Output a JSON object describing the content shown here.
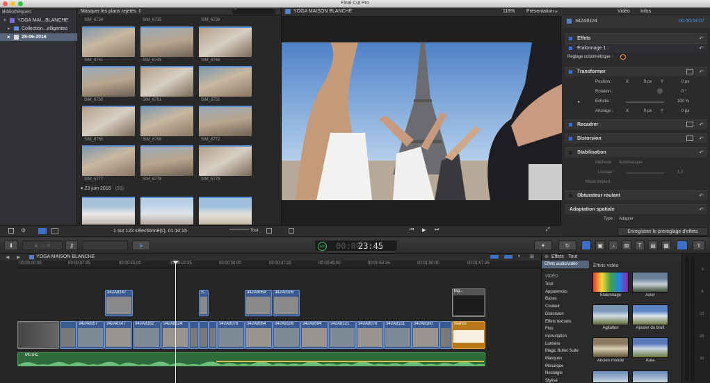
{
  "window": {
    "title": "Final Cut Pro"
  },
  "library": {
    "header": "Bibliothèques",
    "items": [
      {
        "label": "YOGA MAI...BLANCHE",
        "selected": false
      },
      {
        "label": "Collection...elligentes",
        "selected": false
      },
      {
        "label": "29-06-2016",
        "selected": true
      }
    ]
  },
  "browser": {
    "filter": "Masquer les plans rejetés",
    "top_labels": [
      "SIM_6734",
      "SIM_6735",
      "SIM_6736"
    ],
    "rows": [
      [
        "SIM_6741",
        "SIM_6745",
        "SIM_6746"
      ],
      [
        "SIM_6750",
        "SIM_6751",
        "SIM_6755"
      ],
      [
        "SIM_6765",
        "SIM_6768",
        "SIM_6772"
      ],
      [
        "SIM_6777",
        "SIM_6778",
        "SIM_6779"
      ]
    ],
    "date_header": "23 juin 2016",
    "date_count": "(99)",
    "status": "1 sur 123 sélectionné(s), 01:10:15",
    "all_label": "Tout"
  },
  "viewer": {
    "title": "YOGA MAISON BLANCHE",
    "zoom": "118%",
    "presentation": "Présentation"
  },
  "inspector": {
    "tabs": [
      "Vidéo",
      "Infos"
    ],
    "clip_name": "342A8124",
    "timecode": "00:00:04:07",
    "sections": {
      "effets": "Effets",
      "etalonnage": "Étalonnage 1 :",
      "reglage": "Réglage colorimétrique :",
      "transformer": "Transformer",
      "position": "Position :",
      "rotation": "Rotation :",
      "echelle": "Échelle :",
      "ancrage": "Ancrage :",
      "recadrer": "Recadrer",
      "distorsion": "Distorsion",
      "stabilisation": "Stabilisation",
      "methode": "Méthode :",
      "methode_val": "Automatique",
      "lissage": "Lissage :",
      "lissage_val": "1,0",
      "mode_trepied": "Mode trépied :",
      "obturateur": "Obturateur roulant",
      "adaptation": "Adaptation spatiale",
      "type": "Type :",
      "type_val": "Adapter"
    },
    "values": {
      "x": "X",
      "y": "Y",
      "zero_px": "0 px",
      "zero_deg": "0 °",
      "scale": "100 %"
    },
    "save_button": "Enregistrer le préréglage d'effets"
  },
  "toolbar": {
    "timecode": "23:45",
    "timecode_dim": "00:00",
    "percent": "100"
  },
  "timeline": {
    "project": "YOGA MAISON BLANCHE",
    "ruler": [
      "00:00:00:00",
      "00:00:07:25",
      "00:00:15:00",
      "00:00:22:25",
      "00:00:30:00",
      "00:00:37:25",
      "00:00:45:00",
      "00:00:52:25",
      "00:01:00:00",
      "00:01:07:25"
    ],
    "connected": [
      "342A8147",
      "S...",
      "342A8064",
      "342A8106",
      "log..."
    ],
    "primary": [
      "342A8057",
      "342A8147",
      "342A8162",
      "342A8124",
      "342A8078",
      "342A8064",
      "342A8106",
      "342A8094",
      "342A8121",
      "342A8078",
      "342A8151",
      "342A8160",
      "Blancs"
    ],
    "audio": "MUSIC"
  },
  "effects": {
    "title": "Effets",
    "all": "Tout",
    "header": "Effets audio/vidéo",
    "section": "Effets vidéo",
    "video_label": "VIDÉO",
    "categories": [
      "Tout",
      "Apparences",
      "Bases",
      "Couleur",
      "Distorsion",
      "Effets textuels",
      "Flou",
      "Incrustation",
      "Lumière",
      "Magic Bullet Suite",
      "Masques",
      "Mosaïque",
      "Nostalgie",
      "Stylisé"
    ],
    "items": [
      "Étalonnage",
      "Acier",
      "Agitation",
      "Ajouter du bruit",
      "Ancien monde",
      "Aura"
    ]
  },
  "meters": {
    "labels": [
      "0",
      "-6",
      "-12",
      "-20",
      "-30"
    ]
  },
  "colors": {
    "accent": "#3b6fd8",
    "selection": "#56657a",
    "clip": "#3a5a90",
    "audio": "#2f6b3a",
    "generator": "#b8781a"
  }
}
